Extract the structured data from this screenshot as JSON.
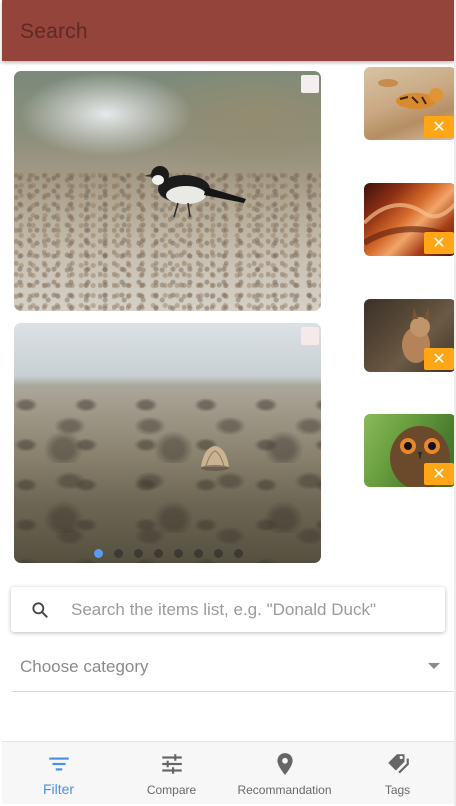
{
  "header": {
    "title": "Search"
  },
  "colors": {
    "header_bg": "#94443a",
    "accent": "#4a8fe7",
    "remove_badge": "#ffa617",
    "active_dot": "#5a9bf2"
  },
  "gallery": {
    "images": [
      {
        "subject": "wagtail bird on gravel"
      },
      {
        "subject": "shell on sand beach"
      }
    ],
    "pagination": {
      "count": 8,
      "active_index": 0
    }
  },
  "selected": {
    "items": [
      {
        "subject": "tiger",
        "remove_label": "✕"
      },
      {
        "subject": "antelope canyon",
        "remove_label": "✕"
      },
      {
        "subject": "lynx",
        "remove_label": "✕"
      },
      {
        "subject": "owl",
        "remove_label": "✕"
      }
    ]
  },
  "search": {
    "placeholder": "Search the items list, e.g. \"Donald Duck\"",
    "value": ""
  },
  "category": {
    "placeholder": "Choose category"
  },
  "nav": {
    "items": [
      {
        "label": "Filter",
        "icon": "filter-icon",
        "active": true
      },
      {
        "label": "Compare",
        "icon": "sliders-icon",
        "active": false
      },
      {
        "label": "Recommandation",
        "icon": "location-pin-icon",
        "active": false
      },
      {
        "label": "Tags",
        "icon": "tags-icon",
        "active": false
      }
    ]
  }
}
